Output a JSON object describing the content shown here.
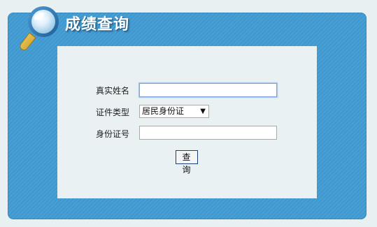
{
  "header": {
    "title": "成绩查询"
  },
  "form": {
    "name_label": "真实姓名",
    "name_value": "",
    "id_type_label": "证件类型",
    "id_type_selected": "居民身份证",
    "id_number_label": "身份证号",
    "id_number_value": "",
    "submit_label": "查 询"
  },
  "icons": {
    "magnifier": "magnifier-icon",
    "select_arrow": "dropdown-arrow-icon"
  },
  "colors": {
    "panel_blue": "#3d98d0",
    "inner_panel": "#e9f1f2",
    "page_background": "#e9f0f2",
    "title_text": "#ffffff"
  }
}
